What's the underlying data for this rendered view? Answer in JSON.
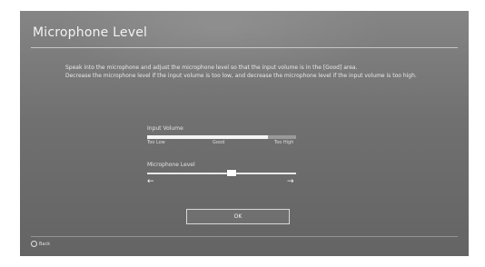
{
  "screen": {
    "title": "Microphone Level",
    "description": [
      "Speak into the microphone and adjust the microphone level so that the input volume is in the [Good] area.",
      "Decrease the microphone level if the input volume is too low, and decrease the microphone level if the input volume is too high."
    ]
  },
  "input_volume": {
    "label": "Input Volume",
    "level_percent": 81,
    "scale": {
      "low": "Too Low",
      "good": "Good",
      "high": "Too High"
    }
  },
  "microphone_level": {
    "label": "Microphone Level",
    "value_percent": 57,
    "decrease_icon": "arrow-left-icon",
    "increase_icon": "arrow-right-icon"
  },
  "ok_button": {
    "label": "OK"
  },
  "footer": {
    "back_label": "Back",
    "back_icon": "circle-button-icon"
  }
}
